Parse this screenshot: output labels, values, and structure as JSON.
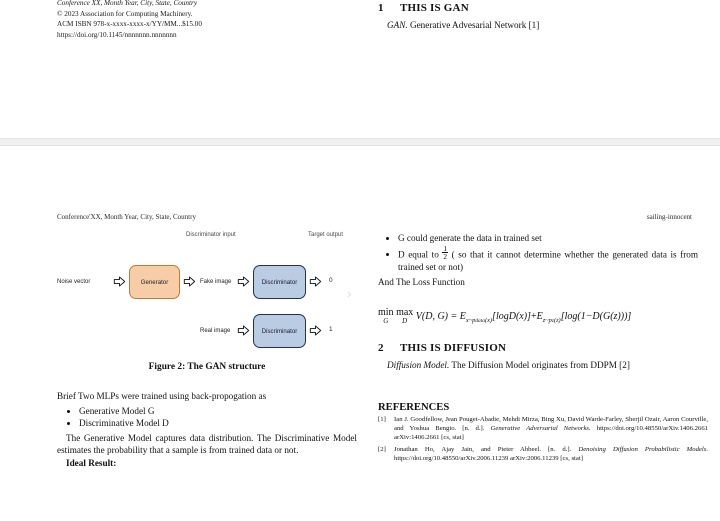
{
  "document": {
    "running_head_left": "Conference'XX, Month Year, City, State, Country",
    "running_head_right": "sailing-innocent"
  },
  "page_one_footer_block": {
    "lines": [
      "Conference XX, Month Year, City, State, Country",
      "© 2023 Association for Computing Machinery.",
      "ACM ISBN 978-x-xxxx-xxxx-x/YY/MM...$15.00",
      "https://doi.org/10.1145/nnnnnnn.nnnnnnn"
    ]
  },
  "section_gan": {
    "number": "1",
    "title": "THIS IS GAN",
    "lead_in": "GAN.",
    "text": "Generative Advesarial Network [1]"
  },
  "figure": {
    "caption": "Figure 2: The GAN structure",
    "label_discriminator_input": "Discriminator input",
    "label_target_output": "Target output",
    "noise_vector": "Noise vector",
    "generator": "Generator",
    "fake_image": "Fake image",
    "real_image": "Real image",
    "discriminator_top": "Discriminator",
    "discriminator_bottom": "Discriminator",
    "output_top": "0",
    "output_bottom": "1",
    "next_chevron": "›",
    "colors": {
      "generator_fill": "#f6cda7",
      "generator_border": "#c07a3a",
      "discriminator_fill": "#b9cce4",
      "discriminator_border": "#24304d"
    }
  },
  "left_body": {
    "intro": "Brief Two MLPs were trained using back-propogation as",
    "bullets": [
      "Generative Model G",
      "Discriminative Model D"
    ],
    "paragraph": "The Generative Model captures data distribution. The Discriminative Model estimates the probability that a sample is from trained data or not.",
    "ideal_result_label": "Ideal Result:"
  },
  "right_body": {
    "bullets": [
      "G could generate the data in trained set",
      "D equal to "
    ],
    "bullet2_fraction_num": "1",
    "bullet2_fraction_den": "2",
    "bullet2_tail": "( so that it cannot determine whether the generated data is from trained set or not)",
    "loss_lead": "And The Loss Function"
  },
  "equation": {
    "min_op": "min",
    "min_sub": "G",
    "max_op": "max",
    "max_sub": "D",
    "value_fn": "V(D, G) =",
    "term1_e": "E",
    "term1_sub": "x~p",
    "term1_sub2": "data",
    "term1_sub3": "(x)",
    "term1_body": "[logD(x)]",
    "plus": "+",
    "term2_e": "E",
    "term2_sub": "z~p",
    "term2_sub2": "z",
    "term2_sub3": "(z)",
    "term2_body": "[log(1−D(G(z)))]"
  },
  "section_diffusion": {
    "number": "2",
    "title": "THIS IS DIFFUSION",
    "lead_in": "Diffusion Model.",
    "text": "The Diffusion Model originates from DDPM [2]"
  },
  "references": {
    "heading": "REFERENCES",
    "items": [
      {
        "marker": "[1]",
        "authors": "Ian J. Goodfellow, Jean Pouget-Abadie, Mehdi Mirza, Bing Xu, David Warde-Farley, Sherjil Ozair, Aaron Courville, and Yoshua Bengio. [n. d.].",
        "title": "Generative Adversarial Networks.",
        "meta": "https://doi.org/10.48550/arXiv.1406.2661 arXiv:1406.2661 [cs, stat]"
      },
      {
        "marker": "[2]",
        "authors": "Jonathan Ho, Ajay Jain, and Pieter Abbeel. [n. d.].",
        "title": "Denoising Diffusion Probabilistic Models.",
        "meta": "https://doi.org/10.48550/arXiv.2006.11239 arXiv:2006.11239 [cs, stat]"
      }
    ]
  }
}
